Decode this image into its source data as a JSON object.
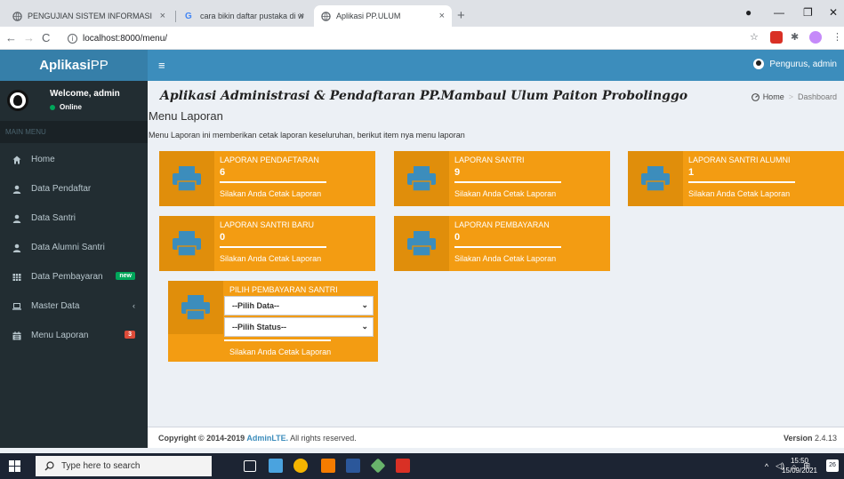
{
  "browser": {
    "tabs": [
      {
        "label": "PENGUJIAN SISTEM INFORMASI",
        "active": false
      },
      {
        "label": "cara bikin daftar pustaka di word",
        "active": false
      },
      {
        "label": "Aplikasi PP.ULUM",
        "active": true
      }
    ],
    "url": "localhost:8000/menu/"
  },
  "header": {
    "logo_bold": "Aplikasi",
    "logo_rest": "PP",
    "user_label": "Pengurus, admin"
  },
  "sidebar": {
    "welcome": "Welcome, admin",
    "status": "Online",
    "section": "MAIN MENU",
    "items": [
      {
        "label": "Home",
        "icon": "home-icon"
      },
      {
        "label": "Data Pendaftar",
        "icon": "user-icon"
      },
      {
        "label": "Data Santri",
        "icon": "user-icon"
      },
      {
        "label": "Data Alumni Santri",
        "icon": "user-icon"
      },
      {
        "label": "Data Pembayaran",
        "icon": "table-icon",
        "badge": "new"
      },
      {
        "label": "Master Data",
        "icon": "laptop-icon"
      },
      {
        "label": "Menu Laporan",
        "icon": "calendar-icon",
        "badge": "3"
      }
    ]
  },
  "content": {
    "title": "Aplikasi Administrasi & Pendaftaran PP.Mambaul Ulum Paiton Probolinggo",
    "breadcrumb": {
      "home": "Home",
      "current": "Dashboard"
    },
    "subtitle": "Menu Laporan",
    "description": "Menu Laporan ini memberikan cetak laporan keseluruhan, berikut item nya menu laporan",
    "cards": [
      {
        "title": "LAPORAN PENDAFTARAN",
        "count": "6",
        "cta": "Silakan Anda Cetak Laporan"
      },
      {
        "title": "LAPORAN SANTRI",
        "count": "9",
        "cta": "Silakan Anda Cetak Laporan"
      },
      {
        "title": "LAPORAN SANTRI ALUMNI",
        "count": "1",
        "cta": "Silakan Anda Cetak Laporan"
      },
      {
        "title": "LAPORAN SANTRI BARU",
        "count": "0",
        "cta": "Silakan Anda Cetak Laporan"
      },
      {
        "title": "LAPORAN PEMBAYARAN",
        "count": "0",
        "cta": "Silakan Anda Cetak Laporan"
      }
    ],
    "payment_card": {
      "title": "PILIH PEMBAYARAN SANTRI",
      "select_data": "--Pilih Data--",
      "select_status": "--Pilih Status--",
      "cta": "Silakan Anda Cetak Laporan"
    }
  },
  "footer": {
    "copyright_pre": "Copyright © 2014-2019 ",
    "copyright_link": "AdminLTE.",
    "copyright_post": " All rights reserved.",
    "version_label": "Version",
    "version_value": "2.4.13"
  },
  "taskbar": {
    "search_placeholder": "Type here to search",
    "time": "15:50",
    "date": "15/09/2021",
    "notifications": "26"
  },
  "colors": {
    "accent": "#3c8dbc",
    "sidebar": "#222d32",
    "card": "#f39c12",
    "card_icon": "#e08e0b"
  }
}
